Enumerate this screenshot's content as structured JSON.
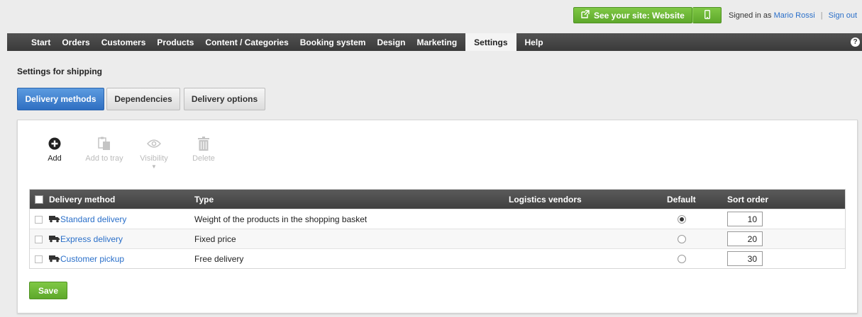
{
  "topbar": {
    "see_site_label": "See your site: Website",
    "signed_in_prefix": "Signed in as",
    "user_name": "Mario Rossi",
    "separator": "|",
    "sign_out_label": "Sign out",
    "accent_color": "#6ab934",
    "icons": {
      "external_link": "external-link-icon",
      "mobile": "mobile-icon"
    }
  },
  "nav": {
    "items": [
      {
        "label": "Start"
      },
      {
        "label": "Orders"
      },
      {
        "label": "Customers"
      },
      {
        "label": "Products"
      },
      {
        "label": "Content / Categories"
      },
      {
        "label": "Booking system"
      },
      {
        "label": "Design"
      },
      {
        "label": "Marketing"
      },
      {
        "label": "Settings",
        "active": true
      },
      {
        "label": "Help"
      }
    ],
    "help_glyph": "?"
  },
  "page": {
    "title": "Settings for shipping"
  },
  "tabs": [
    {
      "label": "Delivery methods",
      "active": true
    },
    {
      "label": "Dependencies"
    },
    {
      "label": "Delivery options"
    }
  ],
  "toolbar": {
    "add_label": "Add",
    "add_to_tray_label": "Add to tray",
    "visibility_label": "Visibility",
    "visibility_caret": "▼",
    "delete_label": "Delete"
  },
  "table": {
    "columns": {
      "method": "Delivery method",
      "type": "Type",
      "logistics": "Logistics vendors",
      "default": "Default",
      "sort": "Sort order"
    },
    "rows": [
      {
        "method": "Standard delivery",
        "type": "Weight of the products in the shopping basket",
        "logistics": "",
        "default": true,
        "sort": "10"
      },
      {
        "method": "Express delivery",
        "type": "Fixed price",
        "logistics": "",
        "default": false,
        "sort": "20"
      },
      {
        "method": "Customer pickup",
        "type": "Free delivery",
        "logistics": "",
        "default": false,
        "sort": "30"
      }
    ]
  },
  "save_label": "Save",
  "colors": {
    "link": "#2a6fc9",
    "tab_active": "#3f80d0",
    "nav_bg": "#444444"
  }
}
